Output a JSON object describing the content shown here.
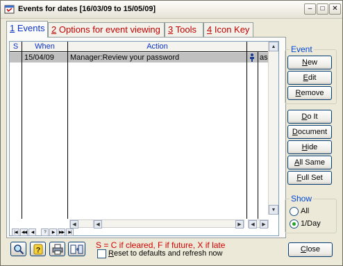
{
  "window": {
    "title": "Events for dates [16/03/09 to 15/05/09]",
    "minimize_glyph": "–",
    "maximize_glyph": "□",
    "close_glyph": "✕"
  },
  "tabs": [
    {
      "num": "1",
      "label": " Events",
      "active": true
    },
    {
      "num": "2",
      "label": " Options for event viewing",
      "active": false
    },
    {
      "num": "3",
      "label": " Tools",
      "active": false
    },
    {
      "num": "4",
      "label": " Icon Key",
      "active": false
    }
  ],
  "grid": {
    "columns": [
      "S",
      "When",
      "Action"
    ],
    "rows": [
      {
        "status": "",
        "when": "15/04/09",
        "action": "Manager:Review your password",
        "icon": "person-icon",
        "extra": "asu"
      }
    ]
  },
  "nav_buttons": [
    "|◀",
    "◀◀",
    "◀",
    "?",
    "▶",
    "▶▶",
    "▶|"
  ],
  "event_group": {
    "label": "Event",
    "buttons": [
      {
        "pre": "",
        "u": "N",
        "post": "ew"
      },
      {
        "pre": "",
        "u": "E",
        "post": "dit"
      },
      {
        "pre": "",
        "u": "R",
        "post": "emove"
      }
    ]
  },
  "action_buttons": [
    {
      "pre": "",
      "u": "D",
      "post": "o It"
    },
    {
      "pre": "",
      "u": "D",
      "post": "ocument"
    },
    {
      "pre": "",
      "u": "H",
      "post": "ide"
    },
    {
      "pre": "",
      "u": "A",
      "post": "ll Same"
    },
    {
      "pre": "",
      "u": "F",
      "post": "ull Set"
    }
  ],
  "show_group": {
    "label": "Show",
    "options": [
      {
        "label": "All",
        "selected": false
      },
      {
        "label": "1/Day",
        "selected": true
      }
    ]
  },
  "footer": {
    "legend": "S = C if cleared, F if future, X if late",
    "reset_label_u": "R",
    "reset_label_rest": "eset to defaults and refresh now",
    "close_u": "C",
    "close_rest": "lose"
  },
  "colors": {
    "active_tab_text": "#0A32C8",
    "inactive_tab_text": "#C00000",
    "row_highlight": "#C0C0C0",
    "legend_text": "#D40000"
  }
}
